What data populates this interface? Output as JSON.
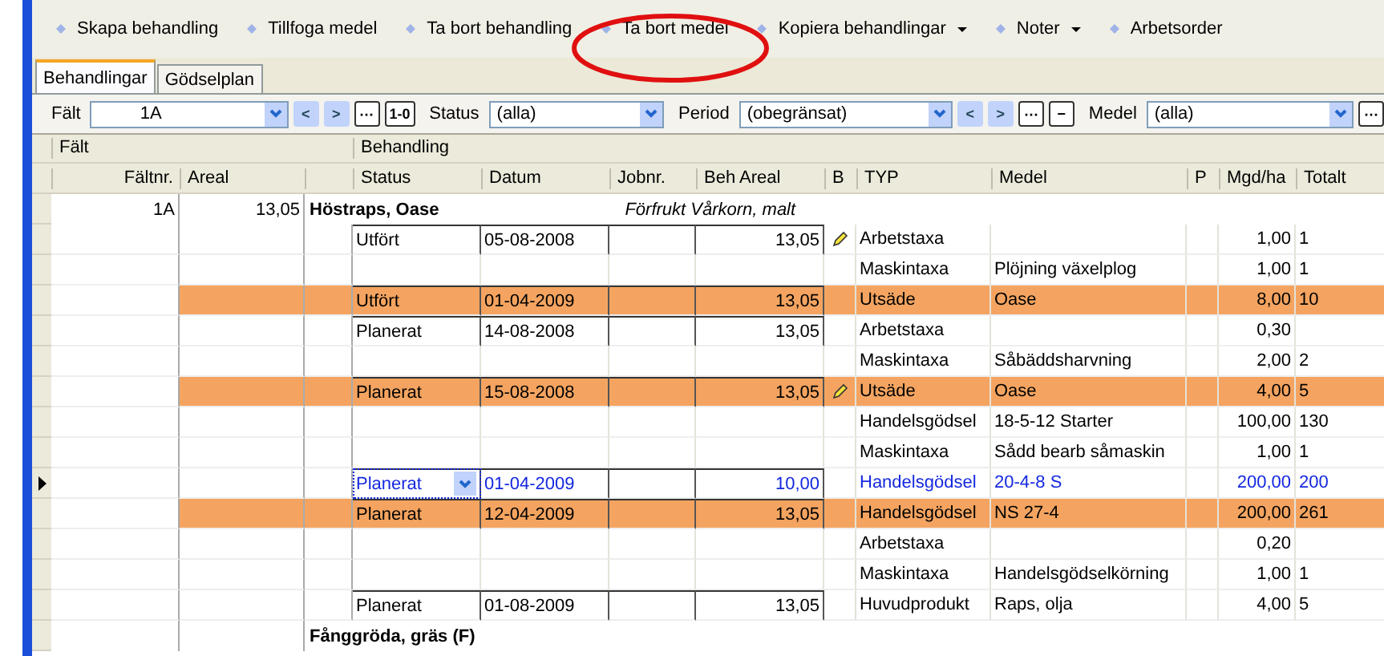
{
  "toolbar": [
    {
      "label": "Skapa behandling",
      "dropdown": false,
      "circled": false
    },
    {
      "label": "Tillfoga medel",
      "dropdown": false,
      "circled": false
    },
    {
      "label": "Ta bort behandling",
      "dropdown": false,
      "circled": false
    },
    {
      "label": "Ta bort medel",
      "dropdown": false,
      "circled": true
    },
    {
      "label": "Kopiera behandlingar",
      "dropdown": true,
      "circled": false
    },
    {
      "label": "Noter",
      "dropdown": true,
      "circled": false
    },
    {
      "label": "Arbetsorder",
      "dropdown": false,
      "circled": false
    }
  ],
  "tabs": [
    {
      "label": "Behandlingar",
      "selected": true
    },
    {
      "label": "Gödselplan",
      "selected": false
    }
  ],
  "filters": [
    {
      "label": "Fält",
      "value": "1A",
      "buttons": [
        "<",
        ">",
        "⋯",
        "1-0"
      ]
    },
    {
      "label": "Status",
      "value": "(alla)"
    },
    {
      "label": "Period",
      "value": "(obegränsat)",
      "buttons": [
        "<",
        ">",
        "⋯",
        "−"
      ]
    },
    {
      "label": "Medel",
      "value": "(alla)",
      "buttons": [
        "⋯"
      ]
    }
  ],
  "group_headers": [
    "Fält",
    "Behandling"
  ],
  "columns": [
    "Fältnr.",
    "Areal",
    "",
    "Status",
    "Datum",
    "Jobnr.",
    "Beh Areal",
    "B",
    "TYP",
    "Medel",
    "P",
    "Mgd/ha",
    "Totalt"
  ],
  "rows": [
    {
      "kind": "group",
      "faltnr": "1A",
      "areal": "13,05",
      "crop": "Höstraps, Oase",
      "note": "Förfrukt Vårkorn, malt"
    },
    {
      "kind": "line",
      "highlighted": false,
      "selected": false,
      "edited": true,
      "status": "Utfört",
      "datum": "05-08-2008",
      "beh_areal": "13,05",
      "typ": "Arbetstaxa",
      "mgd": "1,00",
      "totalt": "1"
    },
    {
      "kind": "line",
      "highlighted": false,
      "selected": false,
      "edited": false,
      "typ": "Maskintaxa",
      "medel": "Plöjning växelplog",
      "mgd": "1,00",
      "totalt": "1"
    },
    {
      "kind": "line",
      "highlighted": true,
      "selected": false,
      "edited": false,
      "status": "Utfört",
      "datum": "01-04-2009",
      "beh_areal": "13,05",
      "typ": "Utsäde",
      "medel": "Oase",
      "mgd": "8,00",
      "totalt": "10"
    },
    {
      "kind": "line",
      "highlighted": false,
      "selected": false,
      "edited": false,
      "status": "Planerat",
      "datum": "14-08-2008",
      "beh_areal": "13,05",
      "typ": "Arbetstaxa",
      "mgd": "0,30"
    },
    {
      "kind": "line",
      "highlighted": false,
      "selected": false,
      "edited": false,
      "typ": "Maskintaxa",
      "medel": "Såbäddsharvning",
      "mgd": "2,00",
      "totalt": "2"
    },
    {
      "kind": "line",
      "highlighted": true,
      "selected": false,
      "edited": true,
      "status": "Planerat",
      "datum": "15-08-2008",
      "beh_areal": "13,05",
      "typ": "Utsäde",
      "medel": "Oase",
      "mgd": "4,00",
      "totalt": "5"
    },
    {
      "kind": "line",
      "highlighted": false,
      "selected": false,
      "edited": false,
      "typ": "Handelsgödsel",
      "medel": "18-5-12 Starter",
      "mgd": "100,00",
      "totalt": "130"
    },
    {
      "kind": "line",
      "highlighted": false,
      "selected": false,
      "edited": false,
      "typ": "Maskintaxa",
      "medel": "Sådd bearb såmaskin",
      "mgd": "1,00",
      "totalt": "1"
    },
    {
      "kind": "line",
      "highlighted": false,
      "selected": true,
      "edited": false,
      "status": "Planerat",
      "datum": "01-04-2009",
      "beh_areal": "10,00",
      "typ": "Handelsgödsel",
      "medel": "20-4-8 S",
      "mgd": "200,00",
      "totalt": "200"
    },
    {
      "kind": "line",
      "highlighted": true,
      "selected": false,
      "edited": false,
      "status": "Planerat",
      "datum": "12-04-2009",
      "beh_areal": "13,05",
      "typ": "Handelsgödsel",
      "medel": "NS 27-4",
      "mgd": "200,00",
      "totalt": "261"
    },
    {
      "kind": "line",
      "highlighted": false,
      "selected": false,
      "edited": false,
      "typ": "Arbetstaxa",
      "mgd": "0,20"
    },
    {
      "kind": "line",
      "highlighted": false,
      "selected": false,
      "edited": false,
      "typ": "Maskintaxa",
      "medel": "Handelsgödselkörning",
      "mgd": "1,00",
      "totalt": "1"
    },
    {
      "kind": "line",
      "highlighted": false,
      "selected": false,
      "edited": false,
      "status": "Planerat",
      "datum": "01-08-2009",
      "beh_areal": "13,05",
      "typ": "Huvudprodukt",
      "medel": "Raps, olja",
      "mgd": "4,00",
      "totalt": "5"
    },
    {
      "kind": "group",
      "crop": "Fånggröda, gräs (F)"
    }
  ]
}
